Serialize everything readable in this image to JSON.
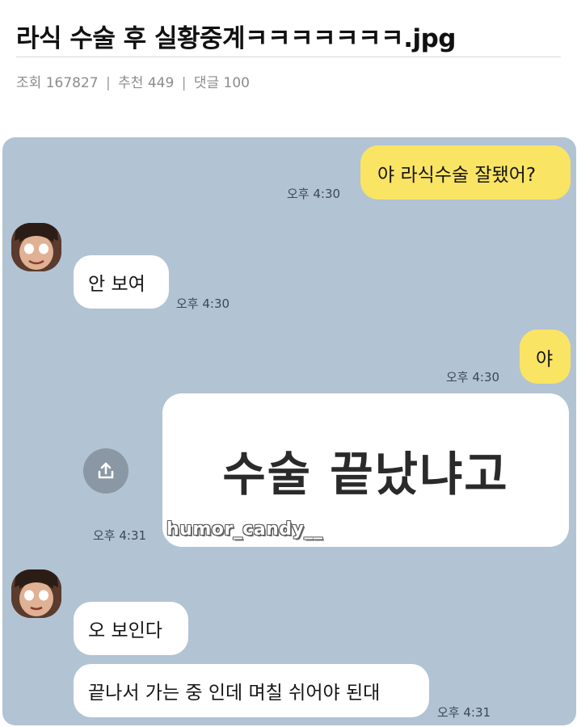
{
  "post": {
    "title": "라식 수술 후 실황중계ㅋㅋㅋㅋㅋㅋㅋ.jpg",
    "views_label": "조회",
    "views": "167827",
    "recommend_label": "추천",
    "recommend": "449",
    "comments_label": "댓글",
    "comments": "100"
  },
  "chat": {
    "messages": [
      {
        "sender": "me",
        "text": "야 라식수술 잘됐어?",
        "time": "오후 4:30"
      },
      {
        "sender": "friend",
        "text": "안 보여",
        "time": "오후 4:30"
      },
      {
        "sender": "me",
        "text": "야",
        "time": "오후 4:30"
      },
      {
        "sender": "me",
        "text": "수술 끝났냐고",
        "time": "오후 4:31"
      },
      {
        "sender": "friend",
        "text": "오 보인다",
        "time": ""
      },
      {
        "sender": "friend",
        "text": "끝나서 가는 중 인데 며칠 쉬어야 된대",
        "time": "오후 4:31"
      }
    ],
    "watermark": "humor_candy__"
  },
  "colors": {
    "chat_background": "#b2c3d3",
    "my_bubble": "#fae464",
    "friend_bubble": "#ffffff",
    "share_button": "#8a97a4"
  },
  "icons": {
    "share": "share-icon",
    "avatar": "avatar"
  }
}
